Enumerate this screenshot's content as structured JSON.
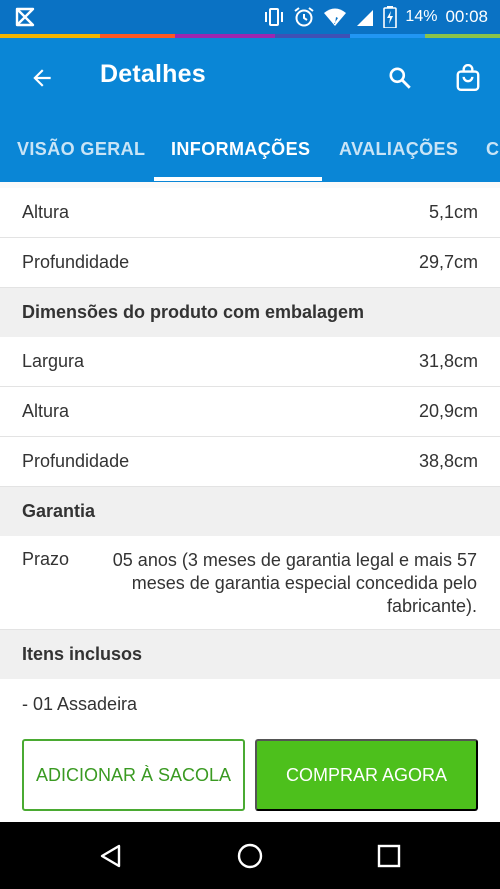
{
  "status_bar": {
    "battery": "14%",
    "time": "00:08",
    "icons": [
      "app-logo-icon",
      "vibrate-icon",
      "alarm-icon",
      "wifi-icon",
      "signal-icon",
      "battery-charging-icon"
    ]
  },
  "app_bar": {
    "title": "Detalhes",
    "icons": [
      "back-arrow-icon",
      "search-icon",
      "shopping-bag-icon"
    ],
    "color": "#0a86d6"
  },
  "tabs": [
    {
      "label": "VISÃO GERAL",
      "active": false
    },
    {
      "label": "INFORMAÇÕES",
      "active": true
    },
    {
      "label": "AVALIAÇÕES",
      "active": false
    },
    {
      "label": "C",
      "active": false
    }
  ],
  "specs": {
    "rows_top": [
      {
        "label": "Altura",
        "value": "5,1cm"
      },
      {
        "label": "Profundidade",
        "value": "29,7cm"
      }
    ],
    "packaged_section": "Dimensões do produto com embalagem",
    "rows_packaged": [
      {
        "label": "Largura",
        "value": "31,8cm"
      },
      {
        "label": "Altura",
        "value": "20,9cm"
      },
      {
        "label": "Profundidade",
        "value": "38,8cm"
      }
    ],
    "warranty_section": "Garantia",
    "warranty": {
      "label": "Prazo",
      "text": "05 anos (3 meses de garantia legal e mais 57 meses de garantia especial concedida pelo fabricante)."
    },
    "included_section": "Itens inclusos",
    "included_items": [
      "- 01 Assadeira"
    ]
  },
  "actions": {
    "add_to_bag": "ADICIONAR À SACOLA",
    "buy_now": "COMPRAR AGORA",
    "accent_green": "#4dc01c"
  },
  "nav_bar": {
    "icons": [
      "back-triangle-icon",
      "home-circle-icon",
      "recents-square-icon"
    ]
  }
}
